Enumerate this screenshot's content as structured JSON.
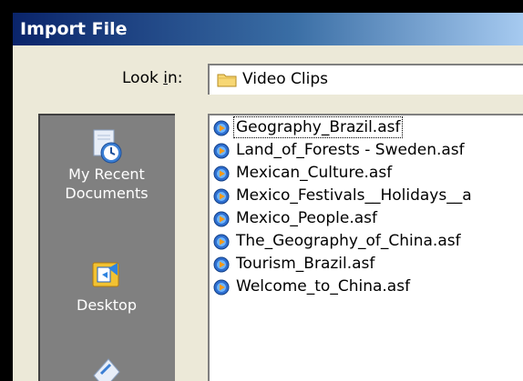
{
  "window": {
    "title": "Import File"
  },
  "lookin": {
    "label": "Look in:",
    "value": "Video Clips",
    "icon": "folder-icon"
  },
  "places": [
    {
      "name": "recent",
      "label_line1": "My Recent",
      "label_line2": "Documents",
      "icon": "recent-documents-icon"
    },
    {
      "name": "desktop",
      "label_line1": "Desktop",
      "label_line2": "",
      "icon": "desktop-icon"
    },
    {
      "name": "my-documents",
      "label_line1": "",
      "label_line2": "",
      "icon": "my-documents-icon"
    }
  ],
  "files": [
    {
      "name": "Geography_Brazil.asf",
      "selected": true,
      "icon": "media-file-icon"
    },
    {
      "name": "Land_of_Forests - Sweden.asf",
      "selected": false,
      "icon": "media-file-icon"
    },
    {
      "name": "Mexican_Culture.asf",
      "selected": false,
      "icon": "media-file-icon"
    },
    {
      "name": "Mexico_Festivals__Holidays__a",
      "selected": false,
      "icon": "media-file-icon"
    },
    {
      "name": "Mexico_People.asf",
      "selected": false,
      "icon": "media-file-icon"
    },
    {
      "name": "The_Geography_of_China.asf",
      "selected": false,
      "icon": "media-file-icon"
    },
    {
      "name": "Tourism_Brazil.asf",
      "selected": false,
      "icon": "media-file-icon"
    },
    {
      "name": "Welcome_to_China.asf",
      "selected": false,
      "icon": "media-file-icon"
    }
  ],
  "colors": {
    "titlebar": "#0a246a",
    "dialog": "#ece9d8",
    "places_bar": "#808080"
  }
}
